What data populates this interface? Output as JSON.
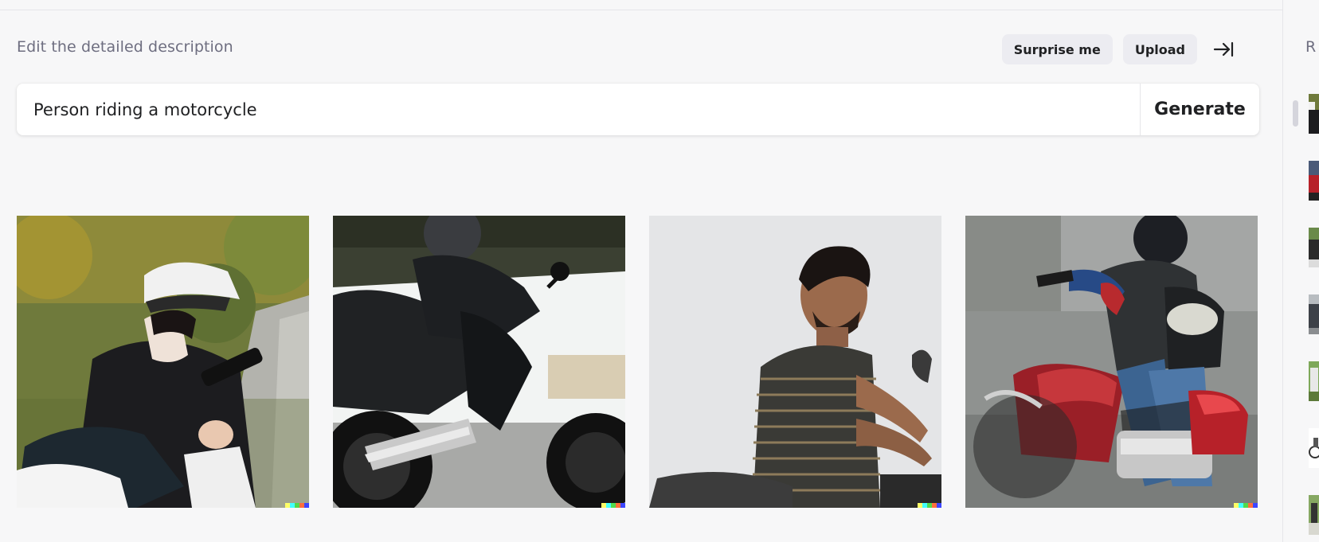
{
  "header": {
    "edit_label": "Edit the detailed description",
    "surprise_label": "Surprise me",
    "upload_label": "Upload"
  },
  "prompt": {
    "value": "Person riding a motorcycle",
    "generate_label": "Generate"
  },
  "gallery": {
    "images": [
      {
        "subject": "woman in white helmet and black leather jacket on white motorcycle"
      },
      {
        "subject": "rider in black leathers on black motorcycle under bridge"
      },
      {
        "subject": "man in striped polo seated on motorcycle against grey wall"
      },
      {
        "subject": "rider in leather vest on red cruiser motorcycle, motion blur"
      }
    ],
    "watermark_colors": [
      "#ffff66",
      "#42ffff",
      "#51da4c",
      "#ff6e3c",
      "#3c46ff"
    ]
  },
  "history": {
    "label": "R"
  },
  "colors": {
    "background": "#f7f7f8",
    "button_bg": "#ececf1",
    "text": "#202123",
    "muted_text": "#6e6e80"
  }
}
